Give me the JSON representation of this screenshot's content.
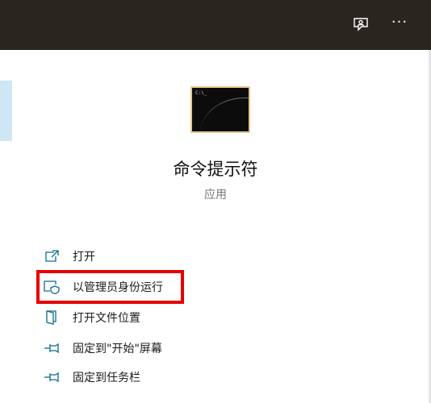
{
  "header": {
    "feedback_icon": "feedback-icon",
    "more_icon": "more-options-icon"
  },
  "app": {
    "icon": "command-prompt-icon",
    "name": "命令提示符",
    "type": "应用"
  },
  "actions": [
    {
      "icon": "open-icon",
      "label": "打开"
    },
    {
      "icon": "shield-admin-icon",
      "label": "以管理员身份运行"
    },
    {
      "icon": "file-location-icon",
      "label": "打开文件位置"
    },
    {
      "icon": "pin-icon",
      "label": "固定到\"开始\"屏幕"
    },
    {
      "icon": "pin-icon",
      "label": "固定到任务栏"
    }
  ],
  "colors": {
    "header_bg": "#2b2520",
    "accent": "#0a6e8a",
    "highlight": "#e60000"
  }
}
